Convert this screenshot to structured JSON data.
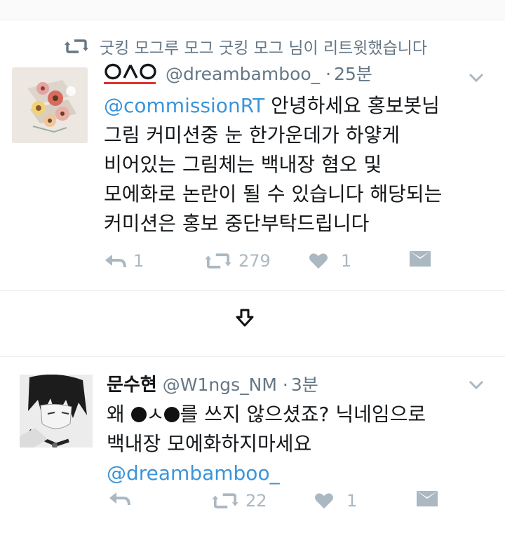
{
  "tweets": [
    {
      "retweet_context": "굿킹 모그루 모그 굿킹 모그 님이 리트윗했습니다",
      "author_name_glyphs": "ㅇㅅㅇ",
      "handle": "@dreambamboo_",
      "separator": "·",
      "time": "25분",
      "body_lines": [
        {
          "mention": "@commissionRT",
          "text": " 안녕하세요 홍보봇님"
        },
        {
          "text": "그림 커미션중 눈 한가운데가 하얗게"
        },
        {
          "text": "비어있는 그림체는 백내장 혐오 및"
        },
        {
          "text": "모에화로 논란이 될 수 있습니다 해당되는"
        },
        {
          "text": "커미션은 홍보 중단부탁드립니다"
        }
      ],
      "actions": {
        "reply": "1",
        "retweet": "279",
        "like": "1"
      },
      "icons": [
        "retweet-icon",
        "reply-icon",
        "heart-icon",
        "dm-envelope-icon",
        "chevron-down-icon"
      ]
    },
    {
      "author_name": "문수현",
      "handle": "@W1ngs_NM",
      "separator": "·",
      "time": "3분",
      "body_line1_start": "왜 ",
      "body_line1_mid": "ㅅ",
      "body_line1_end": "를 쓰지 않으셨죠? 닉네임으로",
      "body_line2": "백내장 모에화하지마세요",
      "body_line3_mention": "@dreambamboo_",
      "actions": {
        "reply": "",
        "retweet": "22",
        "like": "1"
      }
    }
  ],
  "colors": {
    "text": "#14171a",
    "muted": "#657786",
    "icon": "#aab8c2",
    "mention": "#3b94d9",
    "underline": "#e0302e"
  }
}
